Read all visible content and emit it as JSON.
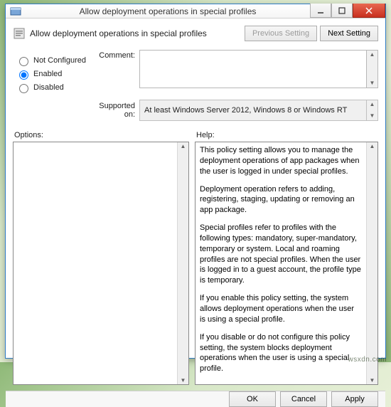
{
  "window": {
    "title": "Allow deployment operations in special profiles"
  },
  "header": {
    "label": "Allow deployment operations in special profiles",
    "prev": "Previous Setting",
    "next": "Next Setting"
  },
  "radios": {
    "not_configured": "Not Configured",
    "enabled": "Enabled",
    "disabled": "Disabled",
    "selected": "enabled"
  },
  "labels": {
    "comment": "Comment:",
    "supported_on": "Supported on:",
    "options": "Options:",
    "help": "Help:"
  },
  "fields": {
    "comment": "",
    "supported_on": "At least Windows Server 2012, Windows 8 or Windows RT"
  },
  "help": {
    "p1": "This policy setting allows you to manage the deployment operations of app packages when the user is logged in under special profiles.",
    "p2": "Deployment operation refers to adding, registering, staging, updating or removing an app package.",
    "p3": "Special profiles refer to profiles with the following types: mandatory, super-mandatory, temporary or system. Local and roaming profiles are not special profiles. When the user is logged in to a guest account, the profile type is temporary.",
    "p4": "If you enable this policy setting, the system allows deployment operations when the user is using a special profile.",
    "p5": "If you disable or do not configure this policy setting, the system blocks deployment operations when the user is using a special profile."
  },
  "footer": {
    "ok": "OK",
    "cancel": "Cancel",
    "apply": "Apply"
  },
  "watermark": "wsxdn.com"
}
